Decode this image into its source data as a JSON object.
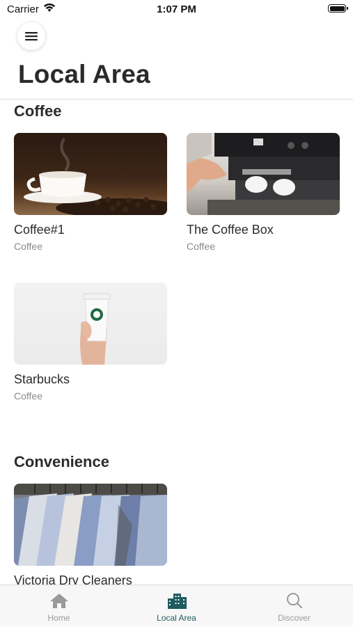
{
  "status_bar": {
    "carrier": "Carrier",
    "time": "1:07 PM"
  },
  "header": {
    "title": "Local Area",
    "menu_icon": "hamburger-menu-icon"
  },
  "sections": [
    {
      "title": "Coffee",
      "places": [
        {
          "name": "Coffee#1",
          "category": "Coffee"
        },
        {
          "name": "The Coffee Box",
          "category": "Coffee"
        },
        {
          "name": "Starbucks",
          "category": "Coffee"
        }
      ]
    },
    {
      "title": "Convenience",
      "places": [
        {
          "name": "Victoria Dry Cleaners",
          "category": ""
        }
      ]
    }
  ],
  "tab_bar": {
    "tabs": [
      {
        "label": "Home",
        "icon": "home-icon",
        "active": false
      },
      {
        "label": "Local Area",
        "icon": "buildings-icon",
        "active": true
      },
      {
        "label": "Discover",
        "icon": "search-icon",
        "active": false
      }
    ],
    "active_color": "#1f5b5f",
    "inactive_color": "#9a9a9a"
  }
}
